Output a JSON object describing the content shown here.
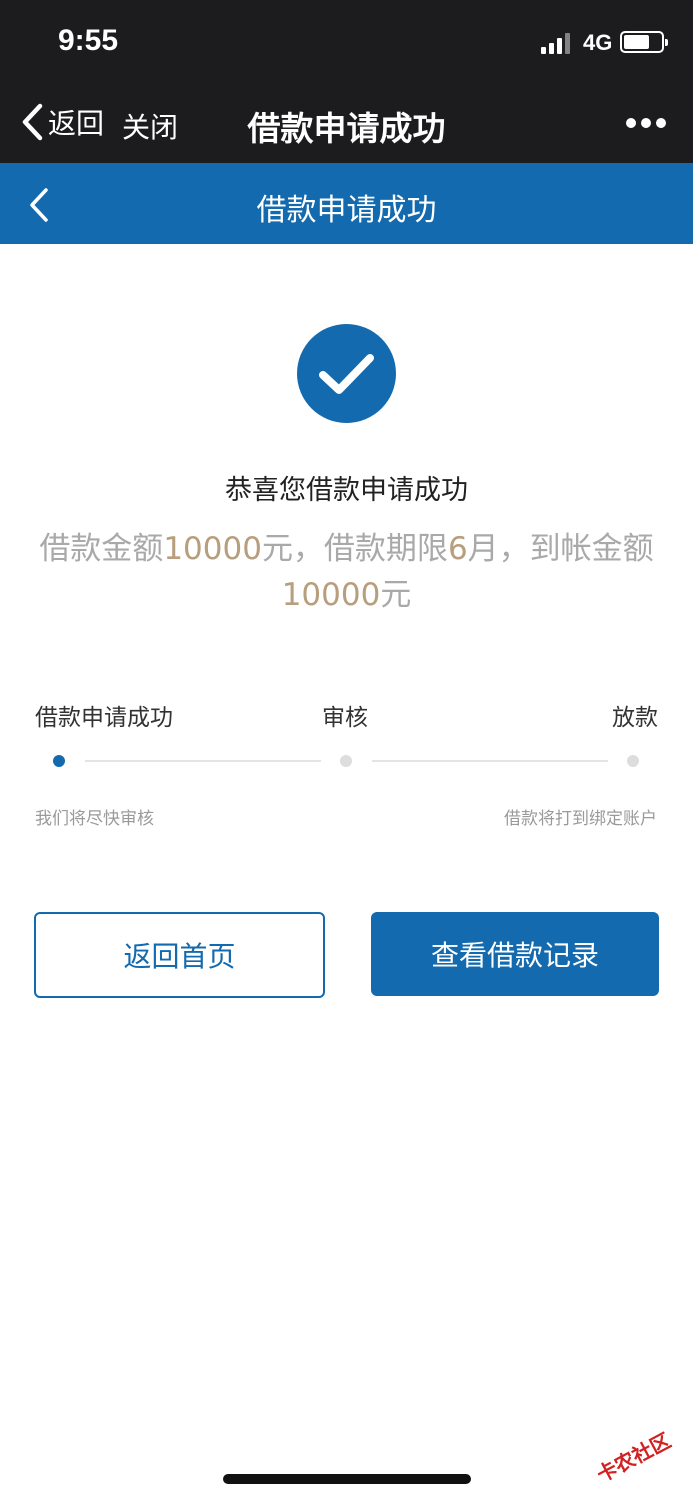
{
  "status_bar": {
    "time": "9:55",
    "network": "4G",
    "battery_level": 0.7
  },
  "nav_bar": {
    "back_label": "返回",
    "close_label": "关闭",
    "title": "借款申请成功"
  },
  "page_header": {
    "title": "借款申请成功"
  },
  "result": {
    "title": "恭喜您借款申请成功",
    "amount_prefix": "借款金额",
    "amount": "10000",
    "amount_unit": "元，借款期限",
    "term": "6",
    "term_unit": "月，到帐金额",
    "received_amount": "10000",
    "received_unit": "元"
  },
  "steps": [
    {
      "label": "借款申请成功",
      "note": "我们将尽快审核",
      "active": true
    },
    {
      "label": "审核",
      "note": "",
      "active": false
    },
    {
      "label": "放款",
      "note": "借款将打到绑定账户",
      "active": false
    }
  ],
  "buttons": {
    "home": "返回首页",
    "records": "查看借款记录"
  },
  "watermark": {
    "text": "卡农社区"
  },
  "colors": {
    "primary": "#146aae",
    "highlight": "#b79e7c",
    "dark_bar": "#1c1c1e"
  }
}
